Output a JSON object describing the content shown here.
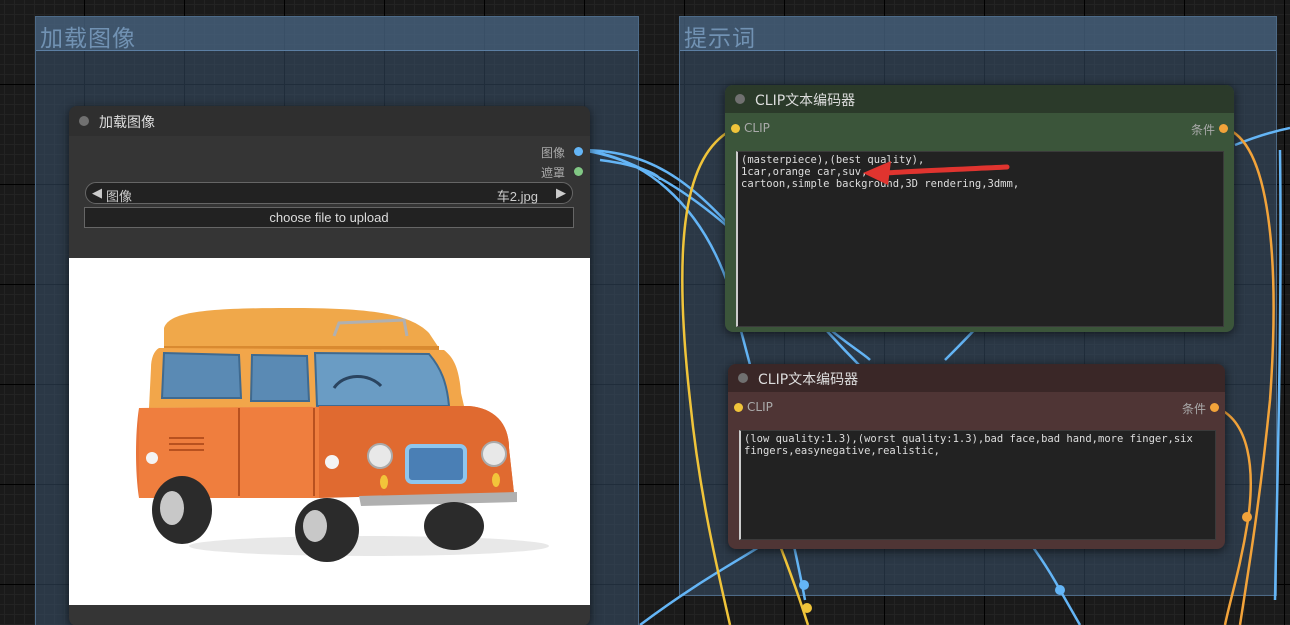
{
  "groups": [
    {
      "title": "加载图像"
    },
    {
      "title": "提示词"
    }
  ],
  "load_image_node": {
    "title": "加载图像",
    "outputs": [
      {
        "label": "图像",
        "color": "#64b5f6"
      },
      {
        "label": "遮罩",
        "color": "#81c784"
      }
    ],
    "image_widget": {
      "label": "图像",
      "value": "车2.jpg"
    },
    "upload_label": "choose file to upload",
    "preview_subject": "cartoon orange car illustration"
  },
  "clip_positive": {
    "title": "CLIP文本编码器",
    "input_label": "CLIP",
    "output_label": "条件",
    "text_lines": [
      "(masterpiece),(best quality),",
      "1car,orange car,suv,",
      "cartoon,simple background,3D rendering,3dmm,"
    ],
    "header_color": "#2b3a2a",
    "body_color": "#3b553a"
  },
  "clip_negative": {
    "title": "CLIP文本编码器",
    "input_label": "CLIP",
    "output_label": "条件",
    "text_lines": [
      "(low quality:1.3),(worst quality:1.3),bad face,bad hand,more finger,six",
      "fingers,easynegative,realistic,"
    ],
    "header_color": "#3a2727",
    "body_color": "#4f3535"
  },
  "colors": {
    "clip_wire": "#f0c43a",
    "image_wire": "#64b5f6",
    "cond_wire": "#f2a33a",
    "annotation_arrow": "#e0342f"
  }
}
